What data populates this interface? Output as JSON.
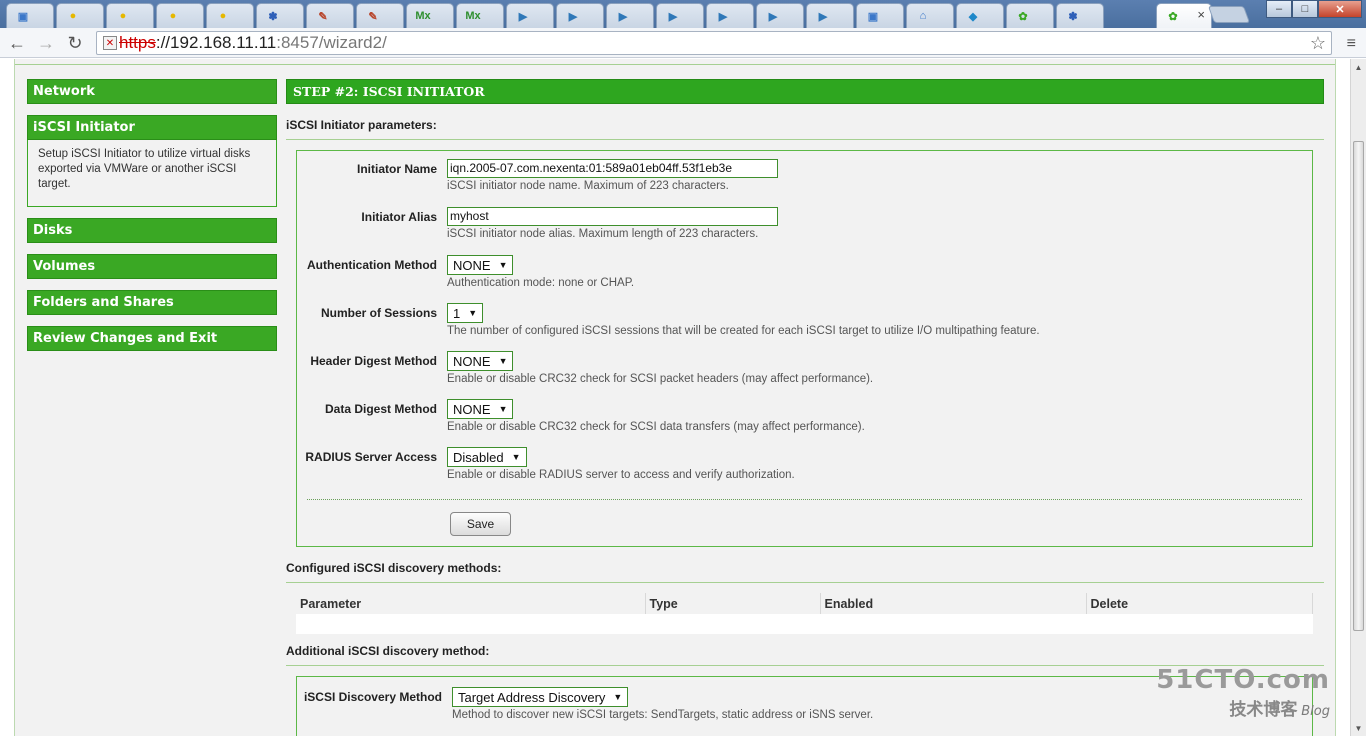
{
  "browser": {
    "tabs": [
      {
        "icon": "document-icon",
        "glyph": "▣",
        "color": "#3b77c9"
      },
      {
        "icon": "yellow-app-icon",
        "glyph": "●",
        "color": "#e6b800"
      },
      {
        "icon": "yellow-app-icon",
        "glyph": "●",
        "color": "#e6b800"
      },
      {
        "icon": "yellow-app-icon",
        "glyph": "●",
        "color": "#e6b800"
      },
      {
        "icon": "yellow-app-icon",
        "glyph": "●",
        "color": "#e6b800"
      },
      {
        "icon": "paw-icon",
        "glyph": "✽",
        "color": "#2e5fb8"
      },
      {
        "icon": "edit-icon",
        "glyph": "✎",
        "color": "#b8452b"
      },
      {
        "icon": "edit-icon",
        "glyph": "✎",
        "color": "#b8452b"
      },
      {
        "icon": "mx-icon",
        "glyph": "Mx",
        "color": "#2f8f2f"
      },
      {
        "icon": "mx-icon",
        "glyph": "Mx",
        "color": "#2f8f2f"
      },
      {
        "icon": "play-icon",
        "glyph": "▶",
        "color": "#2f78b8"
      },
      {
        "icon": "play-icon",
        "glyph": "▶",
        "color": "#2f78b8"
      },
      {
        "icon": "play-icon",
        "glyph": "▶",
        "color": "#2f78b8"
      },
      {
        "icon": "play-icon",
        "glyph": "▶",
        "color": "#2f78b8"
      },
      {
        "icon": "play-icon",
        "glyph": "▶",
        "color": "#2f78b8"
      },
      {
        "icon": "play-icon",
        "glyph": "▶",
        "color": "#2f78b8"
      },
      {
        "icon": "play-icon",
        "glyph": "▶",
        "color": "#2f78b8"
      },
      {
        "icon": "document-icon",
        "glyph": "▣",
        "color": "#3b77c9"
      },
      {
        "icon": "home-icon",
        "glyph": "⌂",
        "color": "#3b77c9"
      },
      {
        "icon": "app-icon",
        "glyph": "◆",
        "color": "#1e88c9"
      },
      {
        "icon": "nexenta-icon",
        "glyph": "✿",
        "color": "#3aa824"
      },
      {
        "icon": "paw-icon",
        "glyph": "✽",
        "color": "#2e5fb8"
      }
    ],
    "active_tab": {
      "icon": "nexenta-icon",
      "glyph": "✿",
      "color": "#3aa824",
      "close": "×"
    },
    "window_buttons": {
      "minimize": "–",
      "maximize": "□",
      "close": "✕"
    },
    "url": {
      "scheme": "https",
      "separator": "://",
      "host": "192.168.11.11",
      "port": ":8457",
      "path": "/wizard2/"
    }
  },
  "sidebar": {
    "items": [
      {
        "label": "Network"
      },
      {
        "label": "iSCSI Initiator",
        "description": "Setup iSCSI Initiator to utilize virtual disks exported via VMWare or another iSCSI target."
      },
      {
        "label": "Disks"
      },
      {
        "label": "Volumes"
      },
      {
        "label": "Folders and Shares"
      },
      {
        "label": "Review Changes and Exit"
      }
    ]
  },
  "main": {
    "step_title": "STEP #2: ISCSI INITIATOR",
    "params_title": "iSCSI Initiator parameters:",
    "fields": [
      {
        "label": "Initiator Name",
        "type": "text",
        "value": "iqn.2005-07.com.nexenta:01:589a01eb04ff.53f1eb3e",
        "hint": "iSCSI initiator node name. Maximum of 223 characters."
      },
      {
        "label": "Initiator Alias",
        "type": "text",
        "value": "myhost",
        "hint": "iSCSI initiator node alias. Maximum length of 223 characters."
      },
      {
        "label": "Authentication Method",
        "type": "select",
        "value": "NONE",
        "hint": "Authentication mode: none or CHAP."
      },
      {
        "label": "Number of Sessions",
        "type": "select",
        "value": "1",
        "hint": "The number of configured iSCSI sessions that will be created for each iSCSI target to utilize I/O multipathing feature."
      },
      {
        "label": "Header Digest Method",
        "type": "select",
        "value": "NONE",
        "hint": "Enable or disable CRC32 check for SCSI packet headers (may affect performance)."
      },
      {
        "label": "Data Digest Method",
        "type": "select",
        "value": "NONE",
        "hint": "Enable or disable CRC32 check for SCSI data transfers (may affect performance)."
      },
      {
        "label": "RADIUS Server Access",
        "type": "select",
        "value": "Disabled",
        "hint": "Enable or disable RADIUS server to access and verify authorization."
      }
    ],
    "save_label": "Save",
    "discovery_title": "Configured iSCSI discovery methods:",
    "discovery_columns": [
      "Parameter",
      "Type",
      "Enabled",
      "Delete"
    ],
    "additional_title": "Additional iSCSI discovery method:",
    "discovery_method": {
      "label": "iSCSI Discovery Method",
      "value": "Target Address Discovery",
      "hint": "Method to discover new iSCSI targets: SendTargets, static address or iSNS server."
    }
  },
  "watermark": {
    "line1": "51CTO.com",
    "line2": "技术博客",
    "line3": "Blog"
  }
}
